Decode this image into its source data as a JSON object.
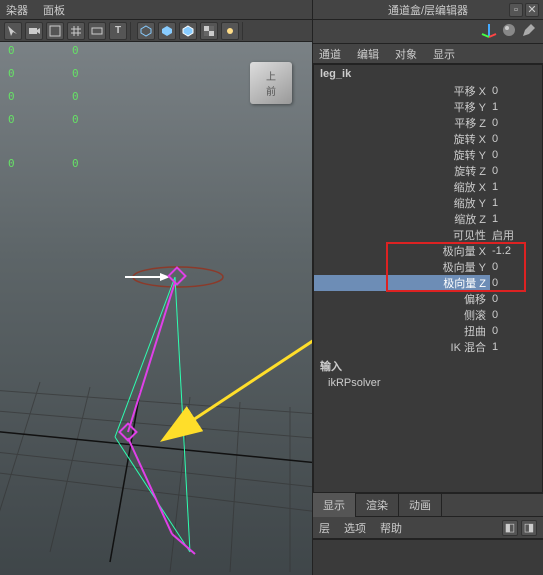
{
  "left_menu": {
    "item0": "染器",
    "item1": "面板"
  },
  "right_title": "通道盒/层编辑器",
  "rp_tabs": {
    "t0": "通道",
    "t1": "编辑",
    "t2": "对象",
    "t3": "显示"
  },
  "object_name": "leg_ik",
  "attrs": {
    "translateX": {
      "label": "平移 X",
      "val": "0"
    },
    "translateY": {
      "label": "平移 Y",
      "val": "1"
    },
    "translateZ": {
      "label": "平移 Z",
      "val": "0"
    },
    "rotateX": {
      "label": "旋转 X",
      "val": "0"
    },
    "rotateY": {
      "label": "旋转 Y",
      "val": "0"
    },
    "rotateZ": {
      "label": "旋转 Z",
      "val": "0"
    },
    "scaleX": {
      "label": "缩放 X",
      "val": "1"
    },
    "scaleY": {
      "label": "缩放 Y",
      "val": "1"
    },
    "scaleZ": {
      "label": "缩放 Z",
      "val": "1"
    },
    "visibility": {
      "label": "可见性",
      "val": "启用"
    },
    "poleX": {
      "label": "极向量 X",
      "val": "-1.2"
    },
    "poleY": {
      "label": "极向量 Y",
      "val": "0"
    },
    "poleZ": {
      "label": "极向量 Z",
      "val": "0"
    },
    "offset": {
      "label": "偏移",
      "val": "0"
    },
    "roll": {
      "label": "侧滚",
      "val": "0"
    },
    "twist": {
      "label": "扭曲",
      "val": "0"
    },
    "ikBlend": {
      "label": "IK 混合",
      "val": "1"
    }
  },
  "section_inputs": "输入",
  "solver": "ikRPsolver",
  "tabs2": {
    "t0": "显示",
    "t1": "渲染",
    "t2": "动画"
  },
  "bottom_menu": {
    "m0": "层",
    "m1": "选项",
    "m2": "帮助"
  },
  "view_cube": {
    "top": "上",
    "front": "前"
  },
  "nums": {
    "z": "0"
  }
}
